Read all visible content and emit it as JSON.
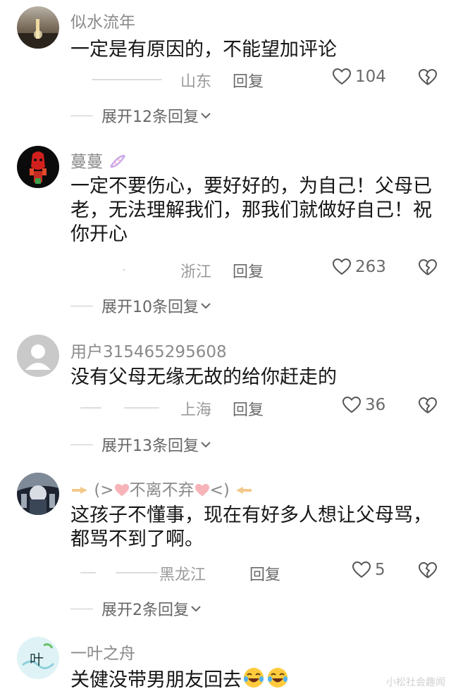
{
  "comments": [
    {
      "username": "似水流年",
      "text": "一定是有原因的，不能望加评论",
      "location": "山东",
      "reply_label": "回复",
      "likes": "104",
      "expand_label": "展开12条回复"
    },
    {
      "username": "蔓蔓",
      "text": "一定不要伤心，要好好的，为自己！父母已老，无法理解我们，那我们就做好自己！祝你开心",
      "location": "浙江",
      "reply_label": "回复",
      "likes": "263",
      "expand_label": "展开10条回复"
    },
    {
      "username": "用户315465295608",
      "text": "没有父母无缘无故的给你赶走的",
      "location": "上海",
      "reply_label": "回复",
      "likes": "36",
      "expand_label": "展开13条回复"
    },
    {
      "username": "不离不弃",
      "text": "这孩子不懂事，现在有好多人想让父母骂，都骂不到了啊。",
      "location": "黑龙江",
      "reply_label": "回复",
      "likes": "5",
      "expand_label": "展开2条回复"
    },
    {
      "username": "一叶之舟",
      "text": "关健没带男朋友回去",
      "avatar_text": "叶"
    }
  ],
  "watermark": "小松社会趣闻",
  "colors": {
    "muted": "#8a8a8a",
    "icon": "#6a6a6a"
  },
  "icons": [
    "heart-icon",
    "broken-heart-icon",
    "chevron-down-icon",
    "laughing-emoji-icon"
  ]
}
